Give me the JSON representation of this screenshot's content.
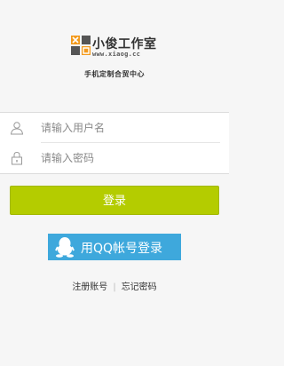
{
  "brand": {
    "title": "小俊工作室",
    "url": "www.xiaog.cc",
    "tagline": "手机定制合贸中心",
    "colors": {
      "orange": "#f39a1d",
      "dark": "#555555"
    }
  },
  "form": {
    "username": {
      "placeholder": "请输入用户名",
      "value": "",
      "icon": "user-icon"
    },
    "password": {
      "placeholder": "请输入密码",
      "value": "",
      "icon": "lock-icon"
    }
  },
  "login_button": {
    "label": "登录",
    "color": "#b4cc00"
  },
  "qq_button": {
    "label": "用QQ帐号登录",
    "icon": "qq-penguin-icon",
    "color": "#3ea8dc"
  },
  "links": {
    "register": "注册账号",
    "separator": "|",
    "forgot": "忘记密码"
  }
}
